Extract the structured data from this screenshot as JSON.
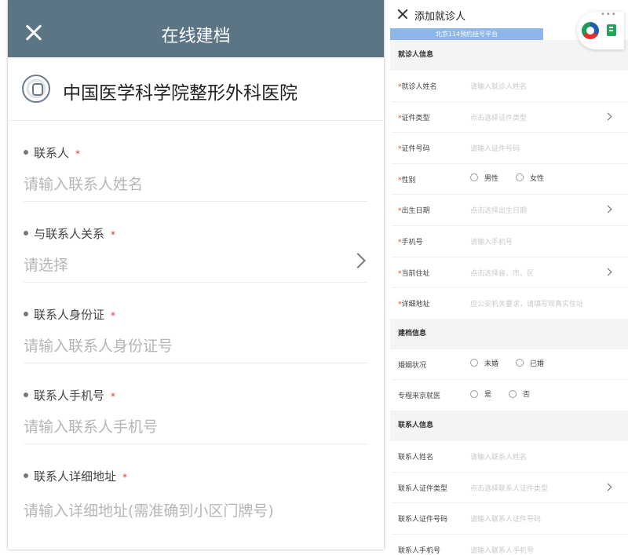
{
  "left": {
    "header": {
      "title": "在线建档"
    },
    "hospital": {
      "name": "中国医学科学院整形外科医院"
    },
    "fields": [
      {
        "label": "联系人",
        "placeholder": "请输入联系人姓名"
      },
      {
        "label": "与联系人关系",
        "placeholder": "请选择"
      },
      {
        "label": "联系人身份证",
        "placeholder": "请输入联系人身份证号"
      },
      {
        "label": "联系人手机号",
        "placeholder": "请输入联系人手机号"
      },
      {
        "label": "联系人详细地址",
        "placeholder": "请输入详细地址(需准确到小区门牌号)"
      }
    ],
    "required_mark": "*"
  },
  "right": {
    "header": {
      "title": "添加就诊人"
    },
    "capsule_dots": "•••",
    "banner": "北京114预约挂号平台",
    "sections": {
      "patient": "就诊人信息",
      "record": "建档信息",
      "contact": "联系人信息"
    },
    "patient_rows": [
      {
        "label": "就诊人姓名",
        "placeholder": "请输入就诊人姓名"
      },
      {
        "label": "证件类型",
        "placeholder": "点击选择证件类型"
      },
      {
        "label": "证件号码",
        "placeholder": "请输入证件号码"
      },
      {
        "label": "性别",
        "options": [
          "男性",
          "女性"
        ]
      },
      {
        "label": "出生日期",
        "placeholder": "点击选择出生日期"
      },
      {
        "label": "手机号",
        "placeholder": "请输入手机号"
      },
      {
        "label": "当前住址",
        "placeholder": "点击选择省、市、区"
      },
      {
        "label": "详细地址",
        "placeholder": "应公安机关要求，请填写现真实住址"
      }
    ],
    "record_rows": [
      {
        "label": "婚姻状况",
        "options": [
          "未婚",
          "已婚"
        ]
      },
      {
        "label": "专程来京就医",
        "options": [
          "是",
          "否"
        ]
      }
    ],
    "contact_rows": [
      {
        "label": "联系人姓名",
        "placeholder": "请输入联系人姓名"
      },
      {
        "label": "联系人证件类型",
        "placeholder": "点击选择联系人证件类型"
      },
      {
        "label": "联系人证件号码",
        "placeholder": "请输入联系人证件号码"
      },
      {
        "label": "联系人手机号",
        "placeholder": "请输入联系人手机号"
      }
    ],
    "required_mark": "*"
  }
}
